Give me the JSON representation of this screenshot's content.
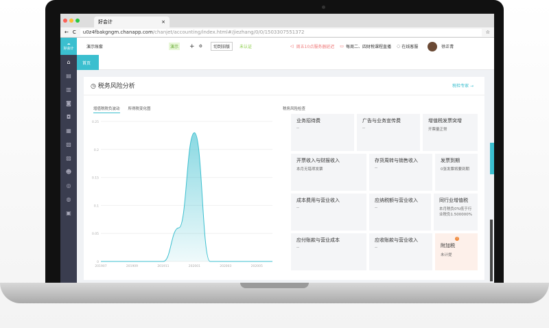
{
  "browser": {
    "tab_title": "好会计",
    "url_host": "u0z4fbakgngm.chanapp.com",
    "url_path": "/chanjet/accounting/index.html#/jiezhang/0/0/1503307551372"
  },
  "header": {
    "account": "演示账套",
    "badge": "演示",
    "switch_btn": "切到旧版",
    "cert": "未认证",
    "notice": "周五10点服务器延迟",
    "live": "每周二、四财税课程直播",
    "service": "在线客服",
    "user": "徐正青",
    "logo_text": "好会计"
  },
  "nav": {
    "home_tab": "首页"
  },
  "panel": {
    "title": "税务风险分析",
    "link": "税检专家 →",
    "tabs": [
      "增值税税负波动",
      "所得税变化图"
    ],
    "right_title": "税务风险检查"
  },
  "risk_cells": [
    {
      "title": "业务招待费",
      "sub": "--"
    },
    {
      "title": "广告与业务宣传费",
      "sub": "--"
    },
    {
      "title": "增值税发票突增",
      "sub": "开票量正常"
    },
    {
      "title": "开票收入与财报收入",
      "sub": "本月无错项发票"
    },
    {
      "title": "存货周转与销售收入",
      "sub": "--"
    },
    {
      "title": "发票到期",
      "sub": "0张发票将要到期"
    },
    {
      "title": "成本费用与营业收入",
      "sub": "--"
    },
    {
      "title": "应纳税额与营业收入",
      "sub": "--"
    },
    {
      "title": "同行业增值税",
      "sub": "本月税负0%低于行业税负1.500000%"
    },
    {
      "title": "应付账款与营业成本",
      "sub": "--"
    },
    {
      "title": "应收账款与营业收入",
      "sub": "--"
    },
    {
      "title": "附加税",
      "sub": "未计提",
      "warn": true
    }
  ],
  "colors": {
    "accent": "#3bbfcf",
    "sidebar": "#3a3d4f",
    "warning": "#f08a3c"
  },
  "chart_data": {
    "type": "area",
    "x": [
      "201907",
      "201908",
      "201909",
      "201910",
      "201911",
      "201912",
      "202001",
      "202002",
      "202003",
      "202004",
      "202005",
      "202006"
    ],
    "x_tick_labels": [
      "201907",
      "201909",
      "201911",
      "202001",
      "202003",
      "202005"
    ],
    "values": [
      0,
      0,
      0,
      0,
      0,
      0.06,
      0.23,
      0,
      0,
      0,
      0,
      0
    ],
    "y_tick_labels": [
      "0",
      "0.05",
      "0.1",
      "0.15",
      "0.2",
      "0.25"
    ],
    "ylim": [
      0,
      0.25
    ],
    "grid": true
  }
}
